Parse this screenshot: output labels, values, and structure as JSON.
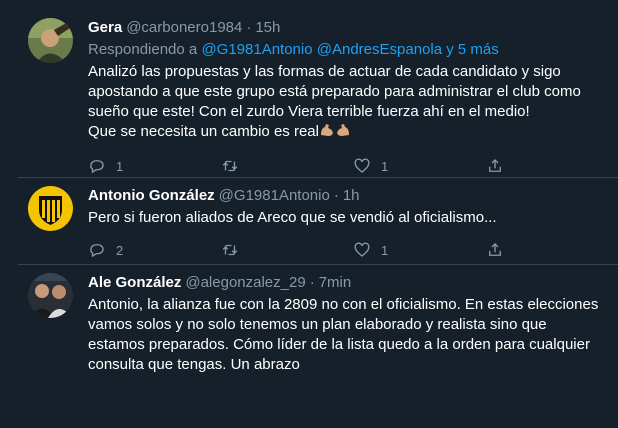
{
  "tweets": [
    {
      "name": "Gera",
      "handle": "@carbonero1984",
      "time": "15h",
      "reply_prefix": "Respondiendo a",
      "reply_to": [
        "@G1981Antonio",
        "@AndresEspanola"
      ],
      "reply_more": "y 5 más",
      "lines": [
        "Analizó las propuestas y las formas de actuar de cada candidato y sigo",
        "apostando a que este grupo está preparado para administrar el club como",
        "sueño que este! Con el zurdo Viera terrible fuerza ahí en el medio!",
        "Que se necesita un cambio es real"
      ],
      "emojis": [
        "flexed-biceps",
        "flexed-biceps"
      ],
      "replies": "1",
      "retweets": "",
      "likes": "1"
    },
    {
      "name": "Antonio González",
      "handle": "@G1981Antonio",
      "time": "1h",
      "lines": [
        "Pero si fueron aliados de Areco que se vendió al oficialismo..."
      ],
      "replies": "2",
      "retweets": "",
      "likes": "1"
    },
    {
      "name": "Ale González",
      "handle": "@alegonzalez_29",
      "time": "7min",
      "lines": [
        "Antonio, la alianza fue con la 2809 no con el oficialismo. En estas elecciones",
        "vamos solos y no solo tenemos un plan elaborado y realista sino que",
        "estamos preparados. Cómo líder de la lista quedo a la orden para cualquier",
        "consulta que tengas. Un abrazo"
      ]
    }
  ],
  "colors": {
    "background": "#15202b",
    "divider": "#38444d",
    "secondary_text": "#8899a6",
    "link": "#1da1f2"
  },
  "icons": [
    "reply-icon",
    "retweet-icon",
    "like-icon",
    "share-icon"
  ]
}
